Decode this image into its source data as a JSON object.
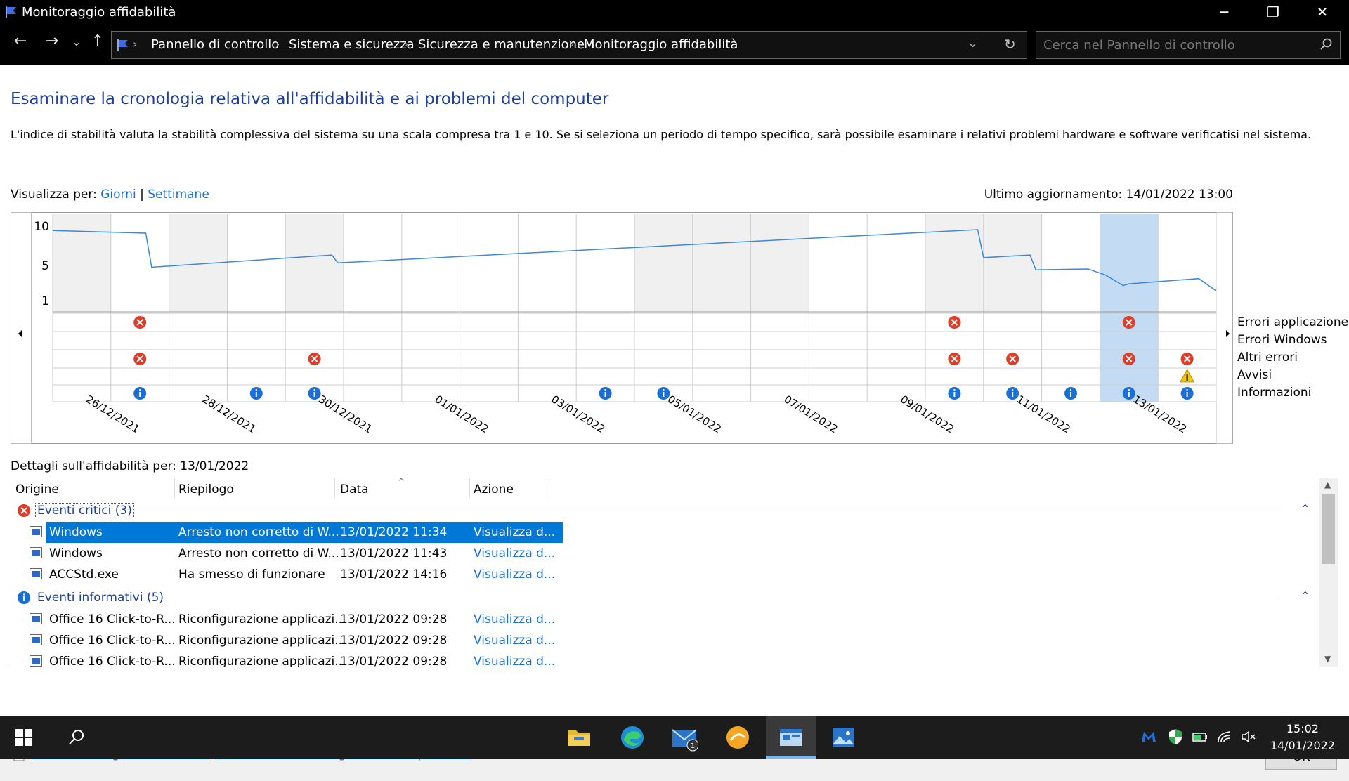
{
  "window": {
    "title": "Monitoraggio affidabilità"
  },
  "address": {
    "crumbs": [
      "Pannello di controllo",
      "Sistema e sicurezza",
      "Sicurezza e manutenzione",
      "Monitoraggio affidabilità"
    ],
    "search_placeholder": "Cerca nel Pannello di controllo"
  },
  "page": {
    "heading": "Esaminare la cronologia relativa all'affidabilità e ai problemi del computer",
    "description": "L'indice di stabilità valuta la stabilità complessiva del sistema su una scala compresa tra 1 e 10. Se si seleziona un periodo di tempo specifico, sarà possibile esaminare i relativi problemi hardware e software verificatisi nel sistema.",
    "view_by": "Visualizza per:",
    "view_days": "Giorni",
    "view_sep": "|",
    "view_weeks": "Settimane",
    "last_update": "Ultimo aggiornamento: 14/01/2022 13:00"
  },
  "chart_data": {
    "type": "line",
    "y_ticks": [
      "10",
      "5",
      "1"
    ],
    "ylim": [
      1,
      10
    ],
    "x_labels": [
      "26/12/2021",
      "28/12/2021",
      "30/12/2021",
      "01/01/2022",
      "03/01/2022",
      "05/01/2022",
      "07/01/2022",
      "09/01/2022",
      "11/01/2022",
      "13/01/2022"
    ],
    "selected_column": "13/01/2022",
    "row_labels": [
      "Errori applicazione",
      "Errori Windows",
      "Altri errori",
      "Avvisi",
      "Informazioni"
    ],
    "colors": {
      "line": "#3a8ad8",
      "error": "#e03c28",
      "info": "#1a6ed8",
      "warning": "#f6c700",
      "selected": "#c3dcf4",
      "shaded": "#f0f0f0"
    }
  },
  "details": {
    "header": "Dettagli sull'affidabilità per: 13/01/2022",
    "columns": [
      "Origine",
      "Riepilogo",
      "Data",
      "Azione"
    ],
    "groups": [
      {
        "title": "Eventi critici (3)",
        "rows": [
          {
            "source": "Windows",
            "summary": "Arresto non corretto di W...",
            "date": "13/01/2022 11:34",
            "action": "Visualizza d..."
          },
          {
            "source": "Windows",
            "summary": "Arresto non corretto di W...",
            "date": "13/01/2022 11:43",
            "action": "Visualizza d..."
          },
          {
            "source": "ACCStd.exe",
            "summary": "Ha smesso di funzionare",
            "date": "13/01/2022 14:16",
            "action": "Visualizza d..."
          }
        ]
      },
      {
        "title": "Eventi informativi (5)",
        "rows": [
          {
            "source": "Office 16 Click-to-R...",
            "summary": "Riconfigurazione applicazi...",
            "date": "13/01/2022 09:28",
            "action": "Visualizza d..."
          },
          {
            "source": "Office 16 Click-to-R...",
            "summary": "Riconfigurazione applicazi...",
            "date": "13/01/2022 09:28",
            "action": "Visualizza d..."
          },
          {
            "source": "Office 16 Click-to-R...",
            "summary": "Riconfigurazione applicazi...",
            "date": "13/01/2022 09:28",
            "action": "Visualizza d..."
          }
        ]
      }
    ]
  },
  "footer": {
    "save_link": "Salva cronologia affidabilità...",
    "all_reports_link": "Visualizza tutte le segnalazioni di problemi",
    "ok": "OK"
  },
  "taskbar": {
    "time": "15:02",
    "date": "14/01/2022",
    "mail_badge": "1"
  }
}
